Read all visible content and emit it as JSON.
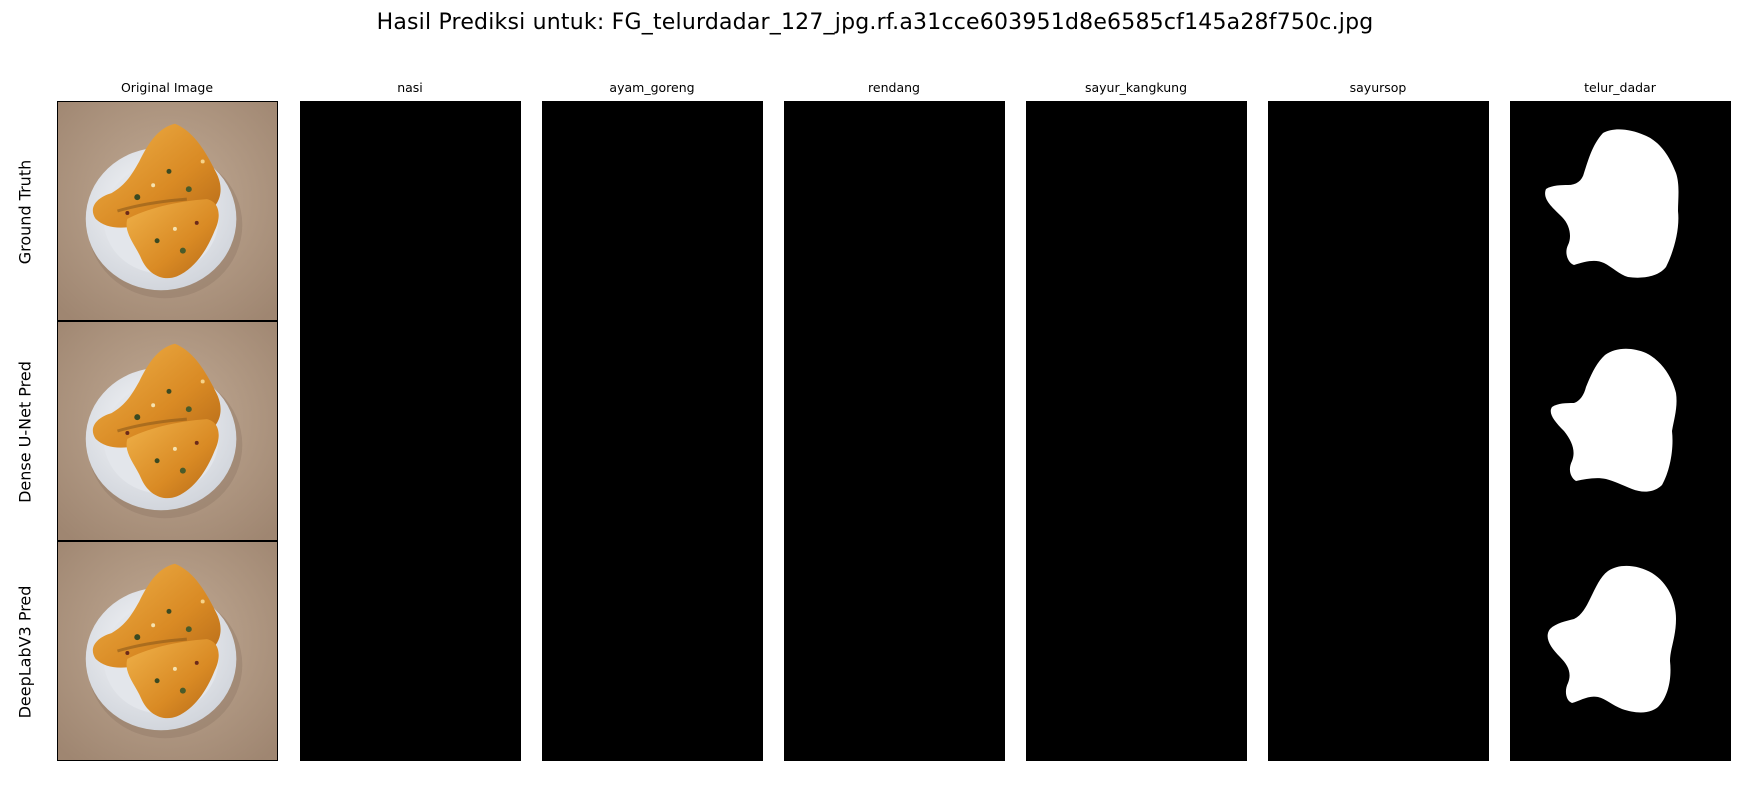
{
  "figure": {
    "title": "Hasil Prediksi untuk: FG_telurdadar_127_jpg.rf.a31cce603951d8e6585cf145a28f750c.jpg"
  },
  "columns": [
    {
      "label": "Original Image"
    },
    {
      "label": "nasi"
    },
    {
      "label": "ayam_goreng"
    },
    {
      "label": "rendang"
    },
    {
      "label": "sayur_kangkung"
    },
    {
      "label": "sayursop"
    },
    {
      "label": "telur_dadar"
    }
  ],
  "rows": [
    {
      "label": "Ground Truth"
    },
    {
      "label": "Dense U-Net Pred"
    },
    {
      "label": "DeepLabV3 Pred"
    }
  ],
  "colors": {
    "mask_background": "#000000",
    "mask_foreground": "#ffffff",
    "plate": "#e9ebef",
    "omelette": "#e0962e",
    "table_surface": "#b49c86"
  }
}
